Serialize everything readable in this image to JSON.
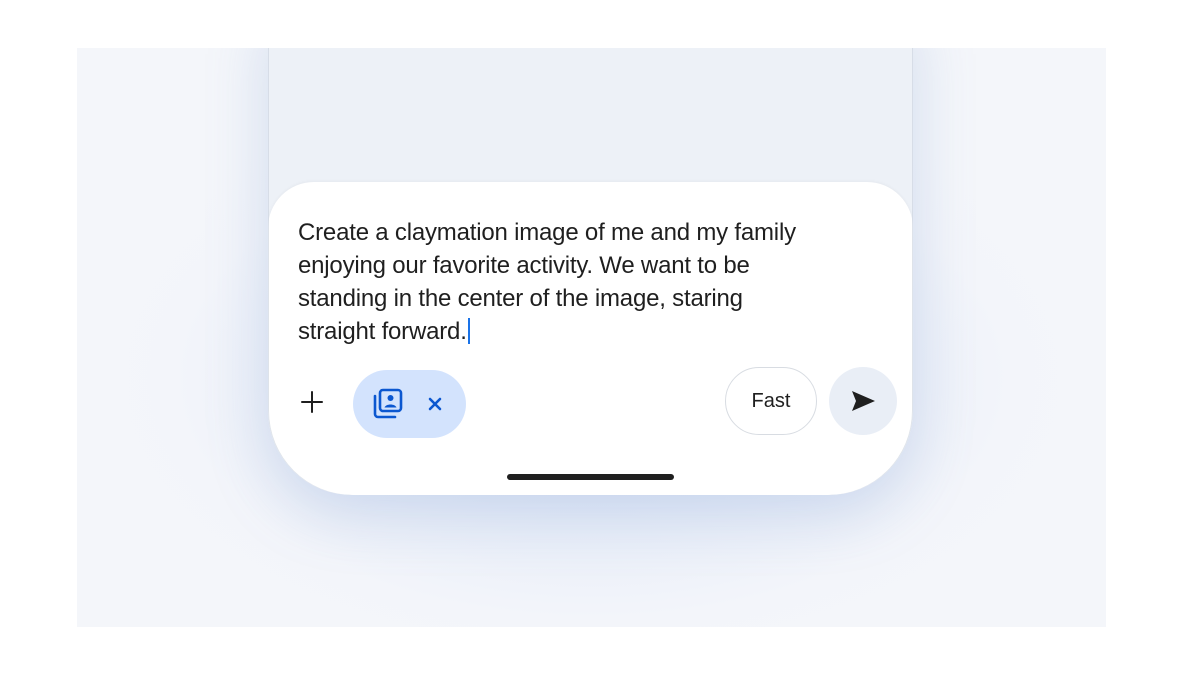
{
  "composer": {
    "prompt": "Create a claymation image of me and my family enjoying our favorite activity. We want to be standing in the center of the image, staring straight forward.",
    "prompt_lines": [
      "Create a claymation image of me and my family",
      "enjoying our favorite activity. We want to be",
      "standing in the center of the image, staring",
      "straight forward."
    ]
  },
  "toolbar": {
    "plus_icon": "plus-icon",
    "attachment_icon": "photo-gallery-icon",
    "remove_icon": "close-icon",
    "mode_label": "Fast",
    "send_icon": "send-icon"
  },
  "colors": {
    "chip_background": "#d3e3fd",
    "chip_icon": "#0b57d0",
    "send_background": "#e9eef6",
    "caret": "#1a73e8"
  }
}
